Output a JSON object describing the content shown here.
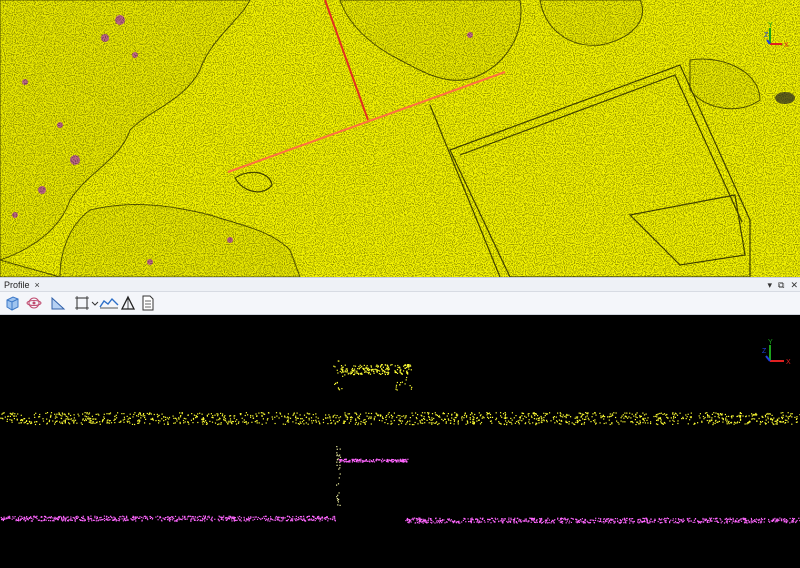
{
  "top_view": {
    "name": "top-view-pointcloud",
    "background_color": "#f2f200",
    "section_line_color": "#ff6a30",
    "axis_gizmo": {
      "y_label": "Y",
      "z_label": "Z",
      "x_label": "X"
    }
  },
  "profile": {
    "tab_title": "Profile",
    "tab_close": "×",
    "window_buttons": {
      "menu": "▾",
      "float": "⧉",
      "close": "✕"
    },
    "toolbar": [
      {
        "name": "view-3d-button",
        "icon": "cube-icon"
      },
      {
        "name": "orbit-button",
        "icon": "orbit-icon"
      },
      {
        "name": "measure-slope-button",
        "icon": "slope-icon"
      },
      {
        "name": "select-box-button",
        "icon": "selection-box-icon"
      },
      {
        "name": "settings-dropdown-button",
        "icon": "dropdown-icon"
      },
      {
        "name": "terrain-profile-button",
        "icon": "profile-icon"
      },
      {
        "name": "triangle-measure-button",
        "icon": "triangle-icon"
      },
      {
        "name": "report-button",
        "icon": "document-icon"
      }
    ],
    "axis_gizmo": {
      "y_label": "Y",
      "z_label": "Z",
      "x_label": "X"
    },
    "colors": {
      "ground": "#ff66ff",
      "canopy": "#ffff33",
      "background": "#000000"
    }
  }
}
